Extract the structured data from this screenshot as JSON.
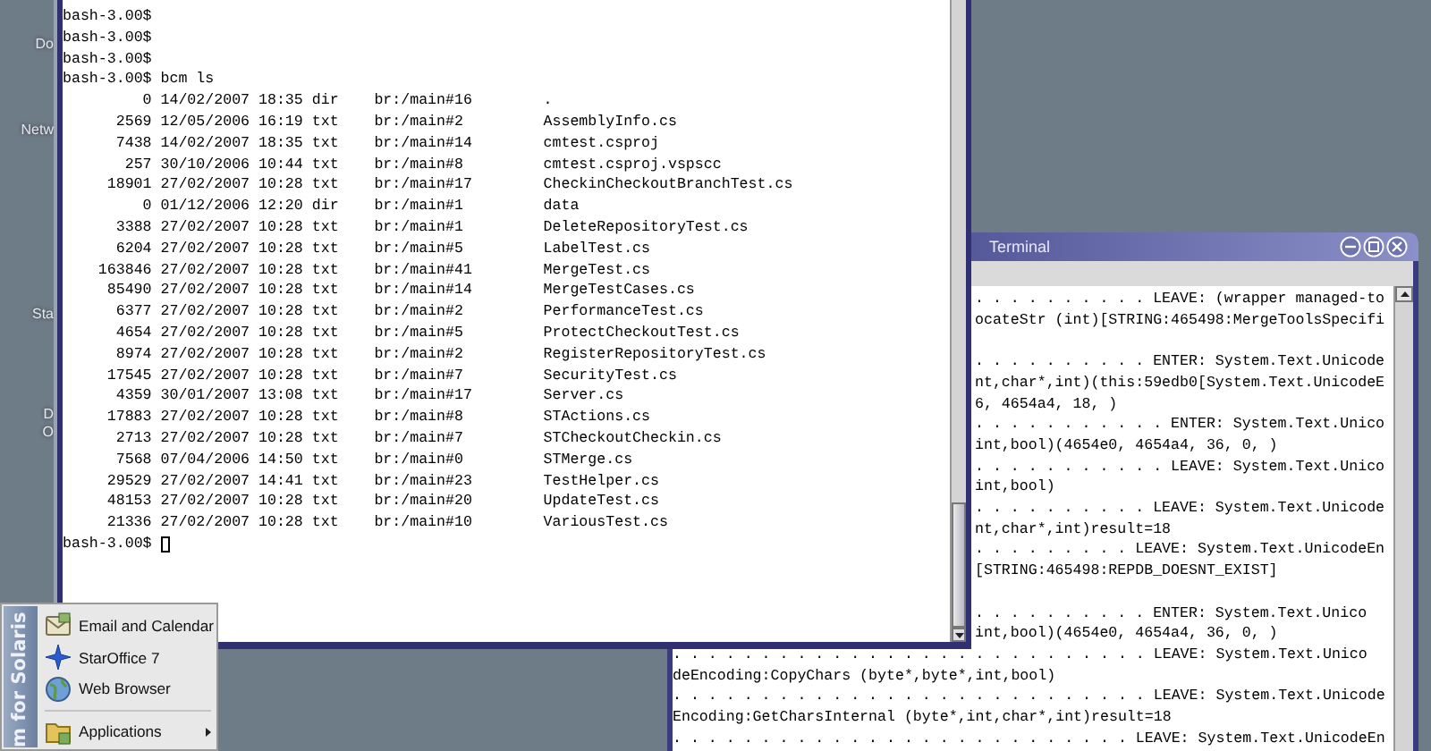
{
  "desktop_icons": [
    {
      "label": "Do"
    },
    {
      "label": "Netw"
    },
    {
      "label": "Sta"
    },
    {
      "label": "D"
    },
    {
      "label": "O"
    }
  ],
  "front_terminal": {
    "prompt_lines": [
      "bash-3.00$",
      "bash-3.00$",
      "bash-3.00$",
      "bash-3.00$ bcm ls"
    ],
    "listing": [
      {
        "size": "0",
        "date": "14/02/2007",
        "time": "18:35",
        "type": "dir",
        "branch": "br:/main#16",
        "name": "."
      },
      {
        "size": "2569",
        "date": "12/05/2006",
        "time": "16:19",
        "type": "txt",
        "branch": "br:/main#2",
        "name": "AssemblyInfo.cs"
      },
      {
        "size": "7438",
        "date": "14/02/2007",
        "time": "18:35",
        "type": "txt",
        "branch": "br:/main#14",
        "name": "cmtest.csproj"
      },
      {
        "size": "257",
        "date": "30/10/2006",
        "time": "10:44",
        "type": "txt",
        "branch": "br:/main#8",
        "name": "cmtest.csproj.vspscc"
      },
      {
        "size": "18901",
        "date": "27/02/2007",
        "time": "10:28",
        "type": "txt",
        "branch": "br:/main#17",
        "name": "CheckinCheckoutBranchTest.cs"
      },
      {
        "size": "0",
        "date": "01/12/2006",
        "time": "12:20",
        "type": "dir",
        "branch": "br:/main#1",
        "name": "data"
      },
      {
        "size": "3388",
        "date": "27/02/2007",
        "time": "10:28",
        "type": "txt",
        "branch": "br:/main#1",
        "name": "DeleteRepositoryTest.cs"
      },
      {
        "size": "6204",
        "date": "27/02/2007",
        "time": "10:28",
        "type": "txt",
        "branch": "br:/main#5",
        "name": "LabelTest.cs"
      },
      {
        "size": "163846",
        "date": "27/02/2007",
        "time": "10:28",
        "type": "txt",
        "branch": "br:/main#41",
        "name": "MergeTest.cs"
      },
      {
        "size": "85490",
        "date": "27/02/2007",
        "time": "10:28",
        "type": "txt",
        "branch": "br:/main#14",
        "name": "MergeTestCases.cs"
      },
      {
        "size": "6377",
        "date": "27/02/2007",
        "time": "10:28",
        "type": "txt",
        "branch": "br:/main#2",
        "name": "PerformanceTest.cs"
      },
      {
        "size": "4654",
        "date": "27/02/2007",
        "time": "10:28",
        "type": "txt",
        "branch": "br:/main#5",
        "name": "ProtectCheckoutTest.cs"
      },
      {
        "size": "8974",
        "date": "27/02/2007",
        "time": "10:28",
        "type": "txt",
        "branch": "br:/main#2",
        "name": "RegisterRepositoryTest.cs"
      },
      {
        "size": "17545",
        "date": "27/02/2007",
        "time": "10:28",
        "type": "txt",
        "branch": "br:/main#7",
        "name": "SecurityTest.cs"
      },
      {
        "size": "4359",
        "date": "30/01/2007",
        "time": "13:08",
        "type": "txt",
        "branch": "br:/main#17",
        "name": "Server.cs"
      },
      {
        "size": "17883",
        "date": "27/02/2007",
        "time": "10:28",
        "type": "txt",
        "branch": "br:/main#8",
        "name": "STActions.cs"
      },
      {
        "size": "2713",
        "date": "27/02/2007",
        "time": "10:28",
        "type": "txt",
        "branch": "br:/main#7",
        "name": "STCheckoutCheckin.cs"
      },
      {
        "size": "7568",
        "date": "07/04/2006",
        "time": "14:50",
        "type": "txt",
        "branch": "br:/main#0",
        "name": "STMerge.cs"
      },
      {
        "size": "29529",
        "date": "27/02/2007",
        "time": "14:41",
        "type": "txt",
        "branch": "br:/main#23",
        "name": "TestHelper.cs"
      },
      {
        "size": "48153",
        "date": "27/02/2007",
        "time": "10:28",
        "type": "txt",
        "branch": "br:/main#20",
        "name": "UpdateTest.cs"
      },
      {
        "size": "21336",
        "date": "27/02/2007",
        "time": "10:28",
        "type": "txt",
        "branch": "br:/main#10",
        "name": "VariousTest.cs"
      }
    ],
    "final_prompt": "bash-3.00$"
  },
  "back_terminal": {
    "title": "Terminal",
    "upper_blocks": [
      [
        ". . . . . . . . . . LEAVE: (wrapper managed-to",
        "ocateStr (int)[STRING:465498:MergeToolsSpecifi"
      ],
      [
        ". . . . . . . . . . ENTER: System.Text.Unicode",
        "nt,char*,int)(this:59edb0[System.Text.UnicodeE",
        "6, 4654a4, 18, )",
        ". . . . . . . . . . . ENTER: System.Text.Unico",
        "int,bool)(4654e0, 4654a4, 36, 0, )",
        ". . . . . . . . . . . LEAVE: System.Text.Unico",
        "int,bool)",
        ". . . . . . . . . . LEAVE: System.Text.Unicode",
        "nt,char*,int)result=18",
        ". . . . . . . . . LEAVE: System.Text.UnicodeEn",
        "[STRING:465498:REPDB_DOESNT_EXIST]"
      ],
      [
        ". . . . . . . . . . ENTER: System.Text.Unico",
        "int,bool)(4654e0, 4654a4, 36, 0, )"
      ]
    ],
    "lower_lines": [
      ". . . . . . . . . . . . . . . . . . . . . . . . . . . LEAVE: System.Text.Unico",
      "deEncoding:CopyChars (byte*,byte*,int,bool)",
      ". . . . . . . . . . . . . . . . . . . . . . . . . . . LEAVE: System.Text.Unicode",
      "Encoding:GetCharsInternal (byte*,int,char*,int)result=18",
      ". . . . . . . . . . . . . . . . . . . . . . . . . . LEAVE: System.Text.UnicodeEn"
    ]
  },
  "start_menu": {
    "banner": "m for Solaris",
    "items": [
      {
        "label": "Email and Calendar",
        "kind": "mail"
      },
      {
        "label": "StarOffice 7",
        "kind": "office"
      },
      {
        "label": "Web Browser",
        "kind": "browser"
      },
      {
        "label": "Applications",
        "kind": "submenu"
      }
    ]
  }
}
